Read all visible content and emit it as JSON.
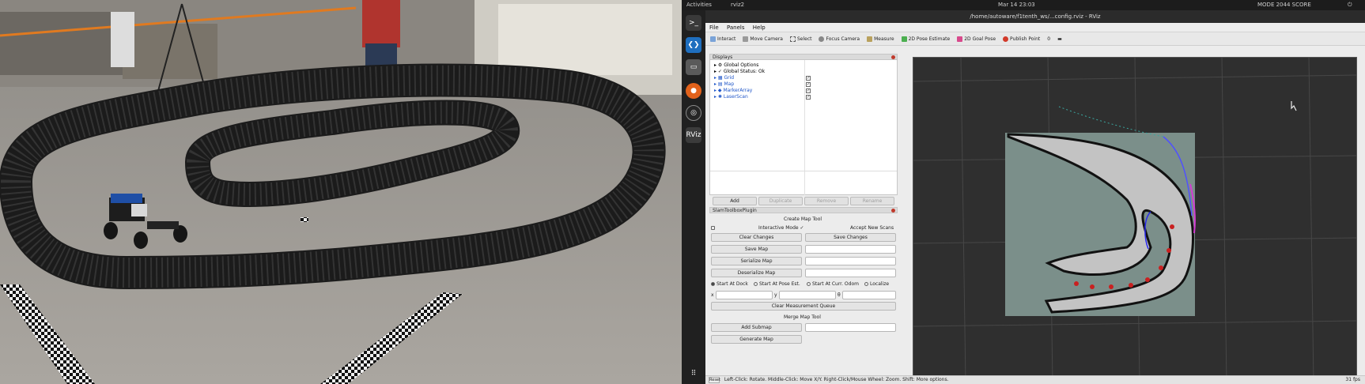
{
  "topbar": {
    "activities": "Activities",
    "app_menu": "rviz2",
    "clock": "Mar 14 23:03",
    "mode": "MODE 2044 SCORE"
  },
  "dock": {
    "icons": [
      "terminal-icon",
      "vscode-icon",
      "files-icon",
      "firefox-icon",
      "obs-icon",
      "rviz-icon",
      "app-grid-icon"
    ],
    "rviz_label": "RViz"
  },
  "window": {
    "title": "/home/autoware/f1tenth_ws/...config.rviz - RViz"
  },
  "menu": [
    "File",
    "Panels",
    "Help"
  ],
  "toolbar": {
    "items": [
      "Interact",
      "Move Camera",
      "Select",
      "Focus Camera",
      "Measure",
      "2D Pose Estimate",
      "2D Goal Pose",
      "Publish Point"
    ],
    "zoom": "0"
  },
  "displays": {
    "title": "Displays",
    "items": [
      {
        "label": "Global Options",
        "blue": false,
        "check": ""
      },
      {
        "label": "Global Status: Ok",
        "blue": false,
        "check": ""
      },
      {
        "label": "Grid",
        "blue": true,
        "check": "✓"
      },
      {
        "label": "Map",
        "blue": true,
        "check": "✓"
      },
      {
        "label": "MarkerArray",
        "blue": true,
        "check": "✓"
      },
      {
        "label": "LaserScan",
        "blue": true,
        "check": "✓"
      }
    ],
    "buttons": {
      "add": "Add",
      "duplicate": "Duplicate",
      "remove": "Remove",
      "rename": "Rename"
    }
  },
  "slam": {
    "title": "SlamToolboxPlugin",
    "create_map_tool": "Create Map Tool",
    "interactive_mode": "Interactive Mode",
    "accept_new_scans": "Accept New Scans",
    "clear_changes": "Clear Changes",
    "save_changes": "Save Changes",
    "save_map": "Save Map",
    "serialize_map": "Serialize Map",
    "deserialize_map": "Deserialize Map",
    "start_at_dock": "Start At Dock",
    "start_at_pose_est": "Start At Pose Est.",
    "start_at_curr_odom": "Start At Curr. Odom",
    "localize": "Localize",
    "y_label": "y",
    "theta_label": "θ",
    "clear_queue": "Clear Measurement Queue",
    "merge_map_tool": "Merge Map Tool",
    "add_submap": "Add Submap",
    "generate_map": "Generate Map"
  },
  "status": {
    "reset": "Reset",
    "hint": "Left-Click: Rotate. Middle-Click: Move X/Y. Right-Click/Mouse Wheel: Zoom. Shift: More options.",
    "fps": "31 fps"
  }
}
